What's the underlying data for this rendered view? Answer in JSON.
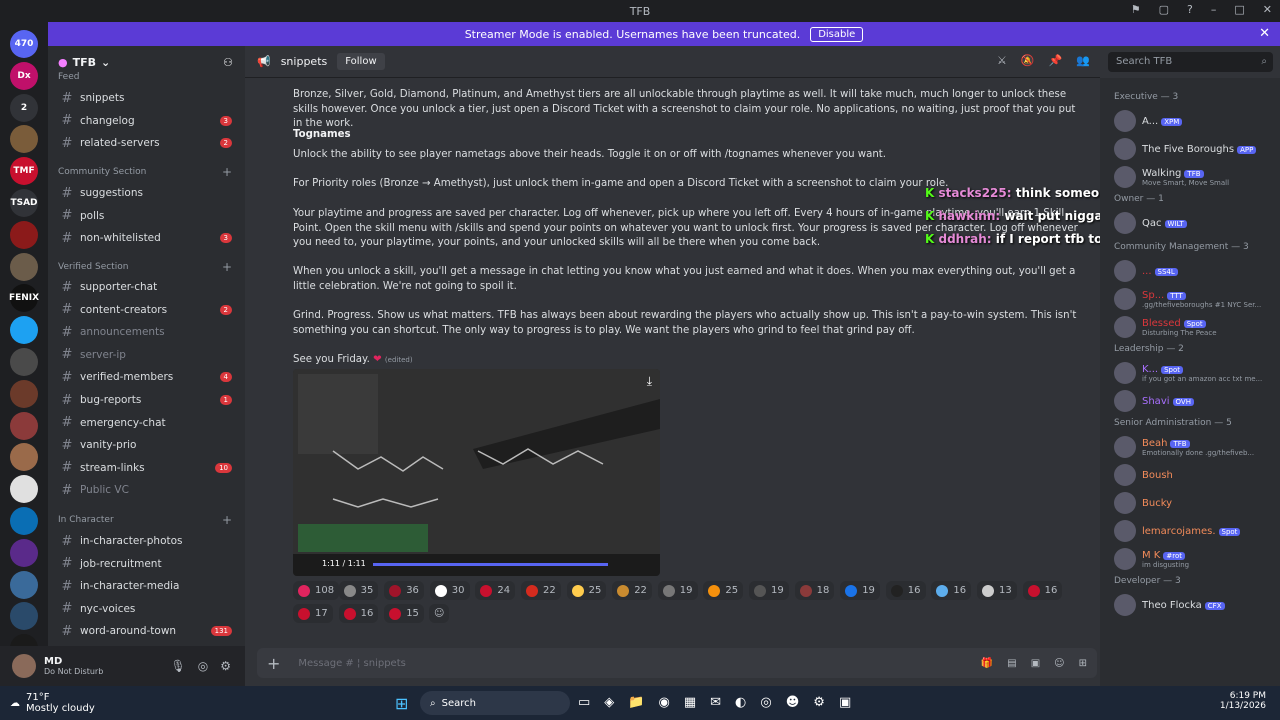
{
  "window": {
    "title": "TFB"
  },
  "banner": {
    "text": "Streamer Mode is enabled. Usernames have been truncated.",
    "disable_label": "Disable"
  },
  "servers": [
    {
      "label": "470",
      "color": "#5865f2"
    },
    {
      "label": "Dx",
      "color": "#c0106a"
    },
    {
      "label": "2",
      "color": "#313338"
    },
    {
      "label": "",
      "color": "#7a5c3a"
    },
    {
      "label": "TMF",
      "color": "#c8102e"
    },
    {
      "label": "TSAD",
      "color": "#313338"
    },
    {
      "label": "",
      "color": "#8b1a1a"
    },
    {
      "label": "",
      "color": "#6b5c4a"
    },
    {
      "label": "FENIX",
      "color": "#111"
    },
    {
      "label": "",
      "color": "#1da1f2"
    },
    {
      "label": "",
      "color": "#4a4a4a"
    },
    {
      "label": "",
      "color": "#6b3a2a"
    },
    {
      "label": "",
      "color": "#8b3a3a"
    },
    {
      "label": "",
      "color": "#9a6a4a"
    },
    {
      "label": "",
      "color": "#e0e0e0"
    },
    {
      "label": "",
      "color": "#0a6eb4"
    },
    {
      "label": "",
      "color": "#5a2a8a"
    },
    {
      "label": "",
      "color": "#3a6a9a"
    },
    {
      "label": "",
      "color": "#2a4a6a"
    },
    {
      "label": "",
      "color": "#1a1a1a"
    }
  ],
  "sidebar": {
    "server_name": "TFB",
    "feed_label": "Feed",
    "channels_top": [
      {
        "name": "snippets",
        "badge": ""
      },
      {
        "name": "changelog",
        "badge": "3"
      },
      {
        "name": "related-servers",
        "badge": "2"
      }
    ],
    "community_label": "Community Section",
    "community": [
      {
        "name": "suggestions",
        "badge": ""
      },
      {
        "name": "polls",
        "badge": ""
      },
      {
        "name": "non-whitelisted",
        "badge": "3"
      }
    ],
    "verified_label": "Verified Section",
    "verified": [
      {
        "name": "supporter-chat",
        "badge": ""
      },
      {
        "name": "content-creators",
        "badge": "2"
      },
      {
        "name": "announcements",
        "badge": "",
        "muted": true
      },
      {
        "name": "server-ip",
        "badge": "",
        "muted": true
      },
      {
        "name": "verified-members",
        "badge": "4"
      },
      {
        "name": "bug-reports",
        "badge": "1"
      },
      {
        "name": "emergency-chat",
        "badge": ""
      },
      {
        "name": "vanity-prio",
        "badge": ""
      },
      {
        "name": "stream-links",
        "badge": "10"
      },
      {
        "name": "Public VC",
        "badge": "",
        "muted": true
      }
    ],
    "ic_label": "In Character",
    "in_character": [
      {
        "name": "in-character-photos",
        "badge": ""
      },
      {
        "name": "job-recruitment",
        "badge": ""
      },
      {
        "name": "in-character-media",
        "badge": ""
      },
      {
        "name": "nyc-voices",
        "badge": ""
      },
      {
        "name": "word-around-town",
        "badge": "131"
      }
    ]
  },
  "user": {
    "name": "MD",
    "status": "Do Not Disturb"
  },
  "chat": {
    "channel": "snippets",
    "follow_label": "Follow",
    "search_placeholder": "Search TFB",
    "composer_placeholder": "Message # ¦ snippets"
  },
  "messages": {
    "p1": "Bronze, Silver, Gold, Diamond, Platinum, and Amethyst tiers are all unlockable through playtime as well. It will take much, much longer to unlock these skills however. Once you unlock a tier, just open a Discord Ticket with a screenshot to claim your role. No applications, no waiting, just proof that you put in the work.",
    "h_tognames": "Tognames",
    "p2": "Unlock the ability to see player nametags above their heads. Toggle it on or off with /tognames whenever you want.",
    "p3": "For Priority roles (Bronze → Amethyst), just unlock them in-game and open a Discord Ticket with a screenshot to claim your role.",
    "p4": "Your playtime and progress are saved per character. Log off whenever, pick up where you left off. Every 4 hours of in-game playtime, you'll earn 1 Skill Point. Open the skill menu with /skills and spend your points on whatever you want to unlock first. Your progress is saved per character. Log off whenever you need to, your playtime, your points, and your unlocked skills will all be there when you come back.",
    "p5": "When you unlock a skill, you'll get a message in chat letting you know what you just earned and what it does. When you max everything out, you'll get a little celebration. We're not going to spoil it.",
    "p6": "Grind. Progress. Show us what matters. TFB has always been about rewarding the players who actually show up. This isn't a pay-to-win system. This isn't something you can shortcut. The only way to progress is to play. We want the players who grind to feel that grind pay off.",
    "p7": "See you Friday.",
    "edited": "(edited)",
    "video_time": "1:11 / 1:11"
  },
  "reactions": [
    {
      "count": "108",
      "color": "#e0245e"
    },
    {
      "count": "35",
      "color": "#888"
    },
    {
      "count": "36",
      "color": "#a0142a"
    },
    {
      "count": "30",
      "color": "#fff"
    },
    {
      "count": "24",
      "color": "#c8102e"
    },
    {
      "count": "22",
      "color": "#d52b1e"
    },
    {
      "count": "25",
      "color": "#ffcc4d"
    },
    {
      "count": "22",
      "color": "#c98b2f"
    },
    {
      "count": "19",
      "color": "#777"
    },
    {
      "count": "25",
      "color": "#f4900c"
    },
    {
      "count": "19",
      "color": "#555"
    },
    {
      "count": "18",
      "color": "#8a3a3a"
    },
    {
      "count": "19",
      "color": "#1a73e8"
    },
    {
      "count": "16",
      "color": "#222"
    },
    {
      "count": "16",
      "color": "#5dadec"
    },
    {
      "count": "13",
      "color": "#ccc"
    },
    {
      "count": "16",
      "color": "#c8102e"
    },
    {
      "count": "17",
      "color": "#c8102e"
    },
    {
      "count": "16",
      "color": "#c8102e"
    },
    {
      "count": "15",
      "color": "#c8102e"
    }
  ],
  "overlay": [
    {
      "user": "stacks225:",
      "text": "think someone tried that and they ain't allow th"
    },
    {
      "user": "hawkinn:",
      "text": "wait put niggas on why u think u gon beef wit"
    },
    {
      "user": "ddhrah:",
      "text": "if I report tfb to rockstars how long ya think Ts gon"
    }
  ],
  "members": {
    "executive": "Executive — 3",
    "exec_list": [
      {
        "name": "A...",
        "tag": "XPM",
        "status": "",
        "color": "#dbdee1"
      },
      {
        "name": "The Five Boroughs",
        "tag": "APP",
        "status": "",
        "color": "#dbdee1"
      },
      {
        "name": "Walking",
        "tag": "TFB",
        "status": "Move Smart, Move Small",
        "color": "#dbdee1"
      }
    ],
    "owner": "Owner — 1",
    "owner_list": [
      {
        "name": "Qac",
        "tag": "WILT",
        "status": "",
        "color": "#dbdee1"
      }
    ],
    "community_mgmt": "Community Management — 3",
    "cm_list": [
      {
        "name": "...",
        "tag": "SS4L",
        "status": "",
        "color": "#da373c"
      },
      {
        "name": "Sp...",
        "tag": "TTT",
        "status": ".gg/thefiveboroughs #1 NYC Ser...",
        "color": "#da373c"
      },
      {
        "name": "Blessed",
        "tag": "Spot",
        "status": "Disturbing The Peace",
        "color": "#da373c"
      }
    ],
    "leadership": "Leadership — 2",
    "lead_list": [
      {
        "name": "K...",
        "tag": "Spot",
        "status": "if you got an amazon acc txt me...",
        "color": "#a970ff"
      },
      {
        "name": "Shavi",
        "tag": "OVH",
        "status": "",
        "color": "#a970ff"
      }
    ],
    "senior_admin": "Senior Administration — 5",
    "sa_list": [
      {
        "name": "Beah",
        "tag": "TFB",
        "status": "Emotionally done .gg/thefiveb...",
        "color": "#f28b5a"
      },
      {
        "name": "Boush",
        "tag": "",
        "status": "",
        "color": "#f28b5a"
      },
      {
        "name": "Bucky",
        "tag": "",
        "status": "",
        "color": "#f28b5a"
      },
      {
        "name": "lemarcojames.",
        "tag": "Spot",
        "status": "",
        "color": "#f28b5a"
      },
      {
        "name": "M K",
        "tag": "#rot",
        "status": "im disgusting",
        "color": "#f28b5a"
      }
    ],
    "developer": "Developer — 3",
    "dev_list": [
      {
        "name": "Theo Flocka",
        "tag": "CFX",
        "status": "",
        "color": "#dbdee1"
      }
    ]
  },
  "taskbar": {
    "weather_temp": "71°F",
    "weather_desc": "Mostly cloudy",
    "search_label": "Search",
    "time": "6:19 PM",
    "date": "1/13/2026"
  }
}
